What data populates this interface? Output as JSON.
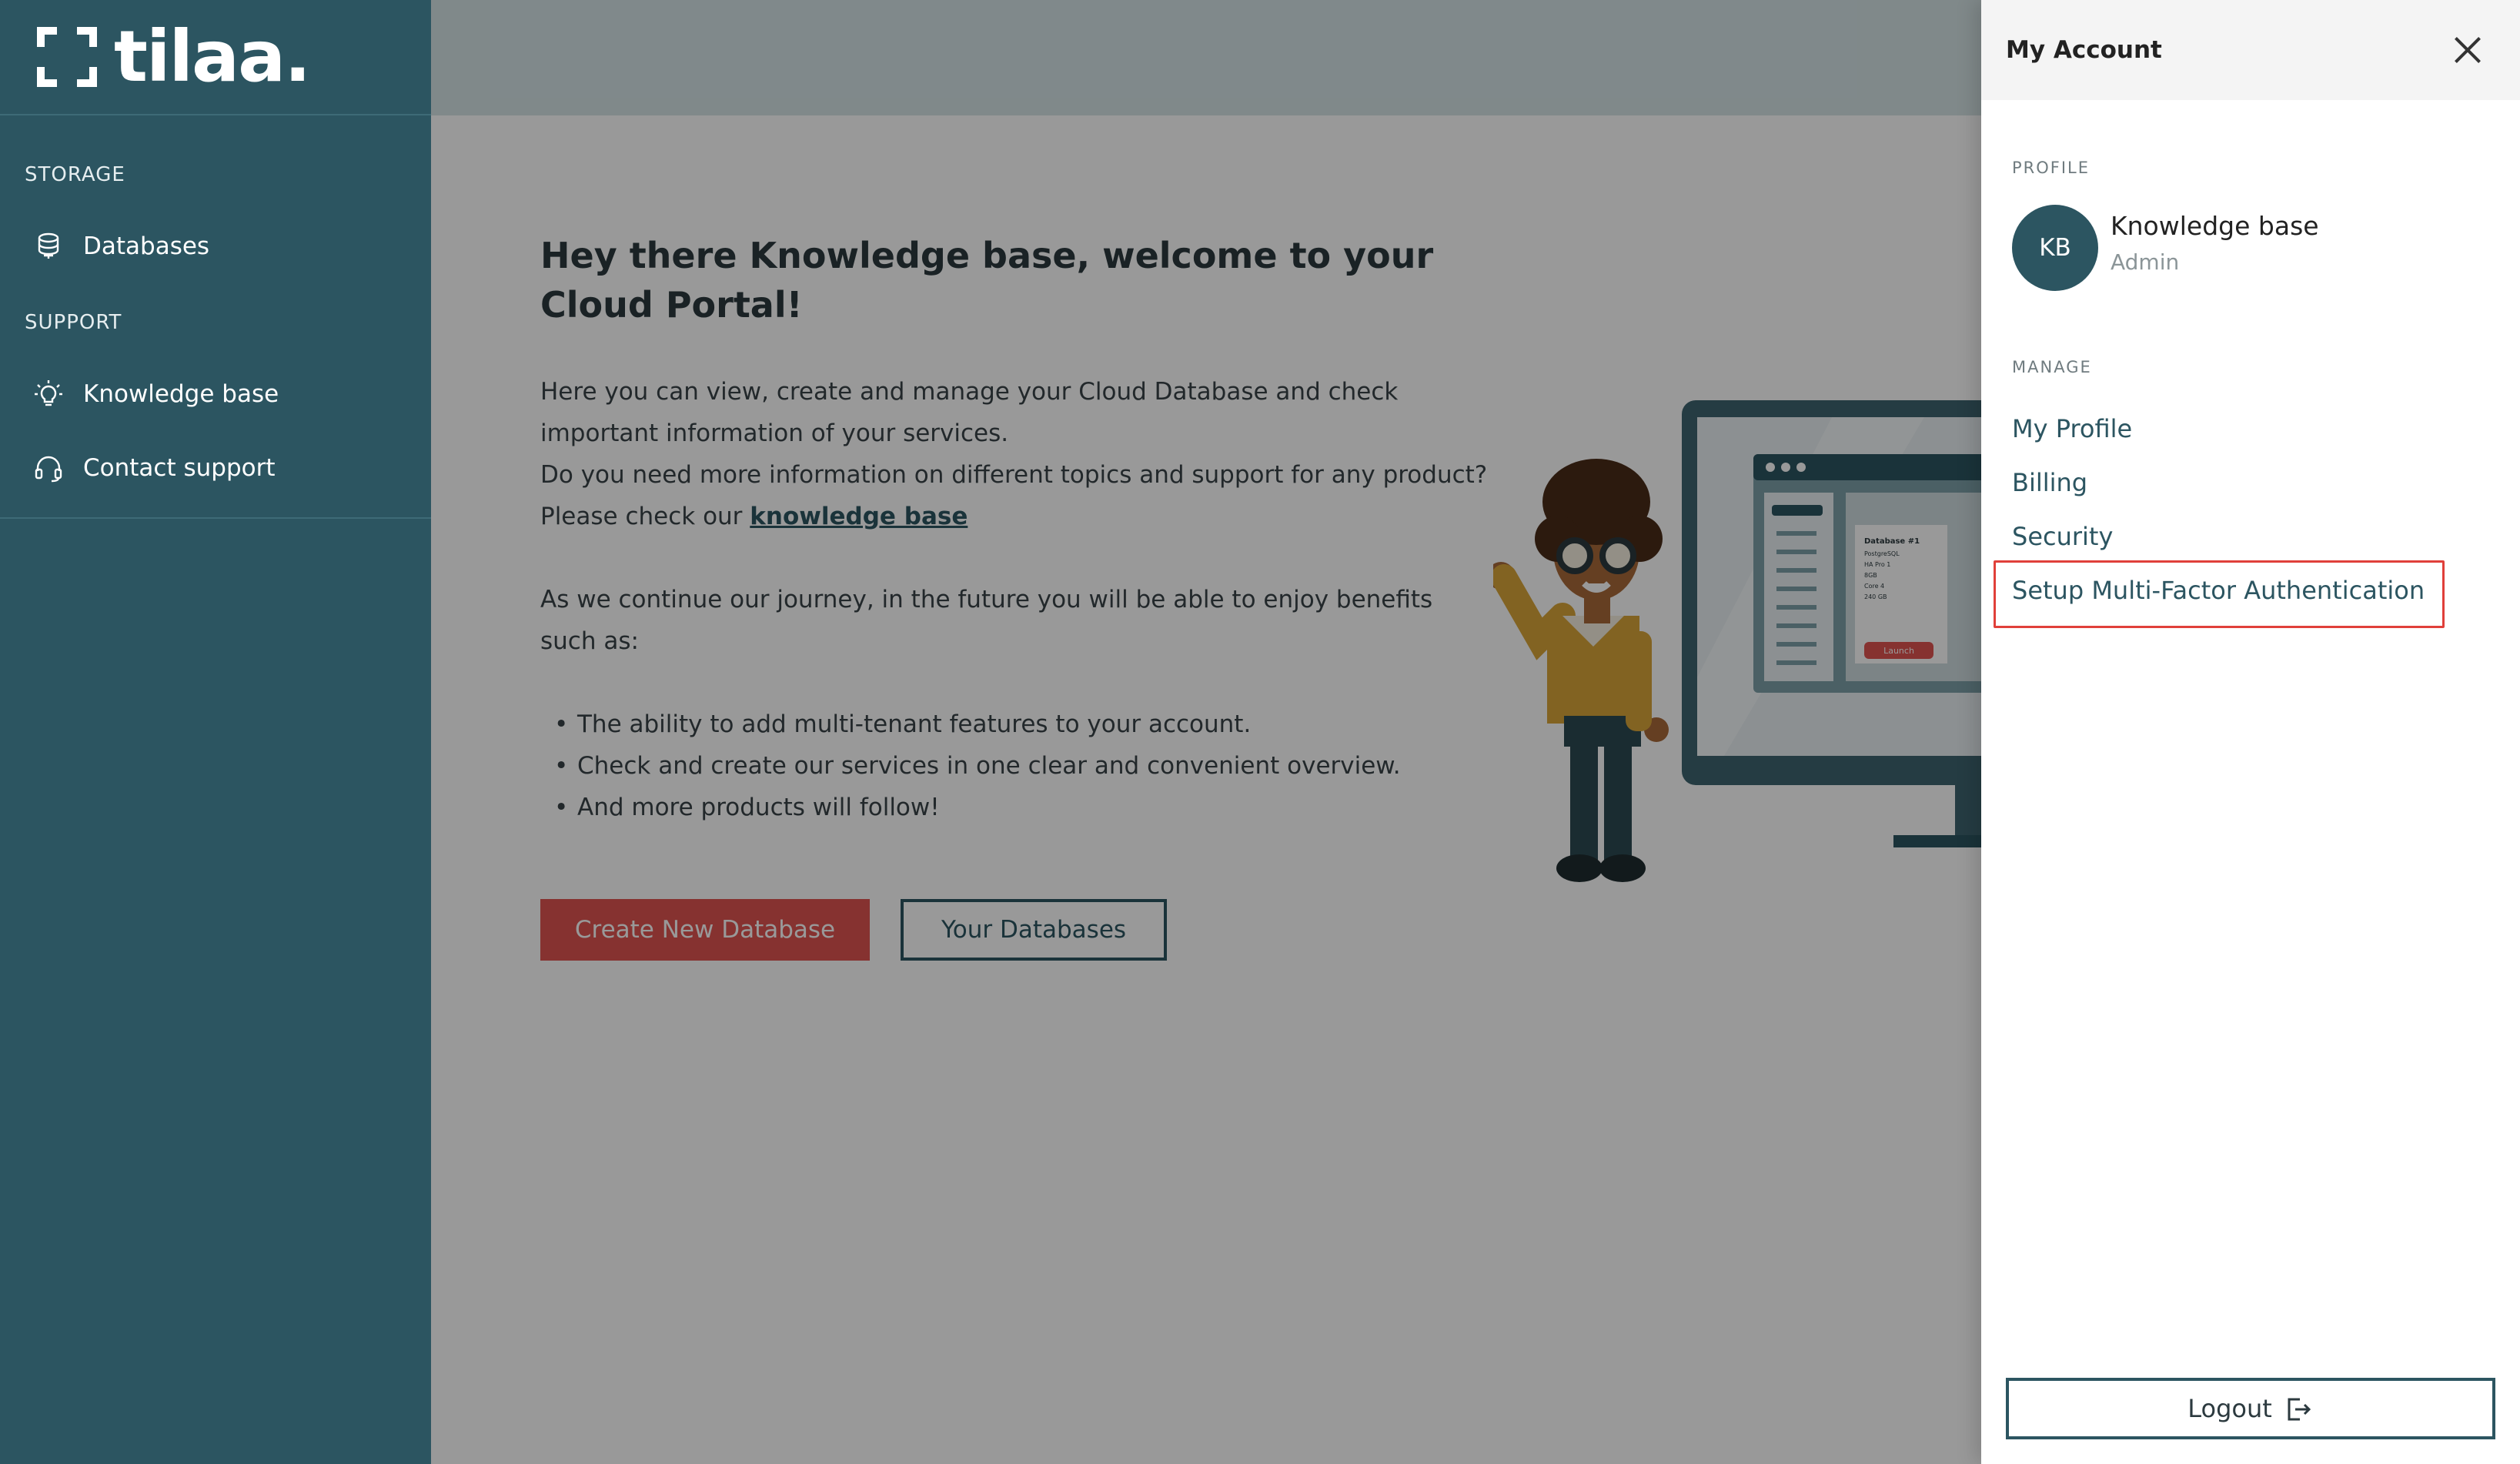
{
  "brand": {
    "name": "tilaa."
  },
  "sidebar": {
    "sections": [
      {
        "label": "STORAGE",
        "items": [
          {
            "label": "Databases",
            "icon": "database-icon"
          }
        ]
      },
      {
        "label": "SUPPORT",
        "items": [
          {
            "label": "Knowledge base",
            "icon": "lightbulb-icon"
          },
          {
            "label": "Contact support",
            "icon": "headset-icon"
          }
        ]
      }
    ]
  },
  "main": {
    "heading": "Hey there Knowledge base, welcome to your Cloud Portal!",
    "para1_line1": "Here you can view, create and manage your Cloud Database and check important information of your services.",
    "para1_line2_prefix": "Do you need more information on different topics and support for any product? Please check our ",
    "para1_link": "knowledge base",
    "para2": "As we continue our journey, in the future you will be able to enjoy benefits such as:",
    "benefits": [
      "The ability to add multi-tenant features to your account.",
      "Check and create our services in one clear and convenient overview.",
      "And more products will follow!"
    ],
    "create_button": "Create New Database",
    "your_databases_button": "Your Databases",
    "illustration": {
      "card_title": "Database #1",
      "card_lines": [
        "PostgreSQL",
        "HA Pro 1",
        "8GB",
        "Core 4",
        "240 GB"
      ],
      "launch_label": "Launch"
    }
  },
  "drawer": {
    "title": "My Account",
    "profile_label": "PROFILE",
    "avatar_initials": "KB",
    "profile_name": "Knowledge base",
    "profile_role": "Admin",
    "manage_label": "MANAGE",
    "menu": {
      "my_profile": "My Profile",
      "billing": "Billing",
      "security": "Security",
      "mfa": "Setup Multi-Factor Authentication"
    },
    "logout": "Logout"
  },
  "colors": {
    "sidebar": "#2c5561",
    "accent_red": "#e05450",
    "highlight": "#e0403a"
  }
}
